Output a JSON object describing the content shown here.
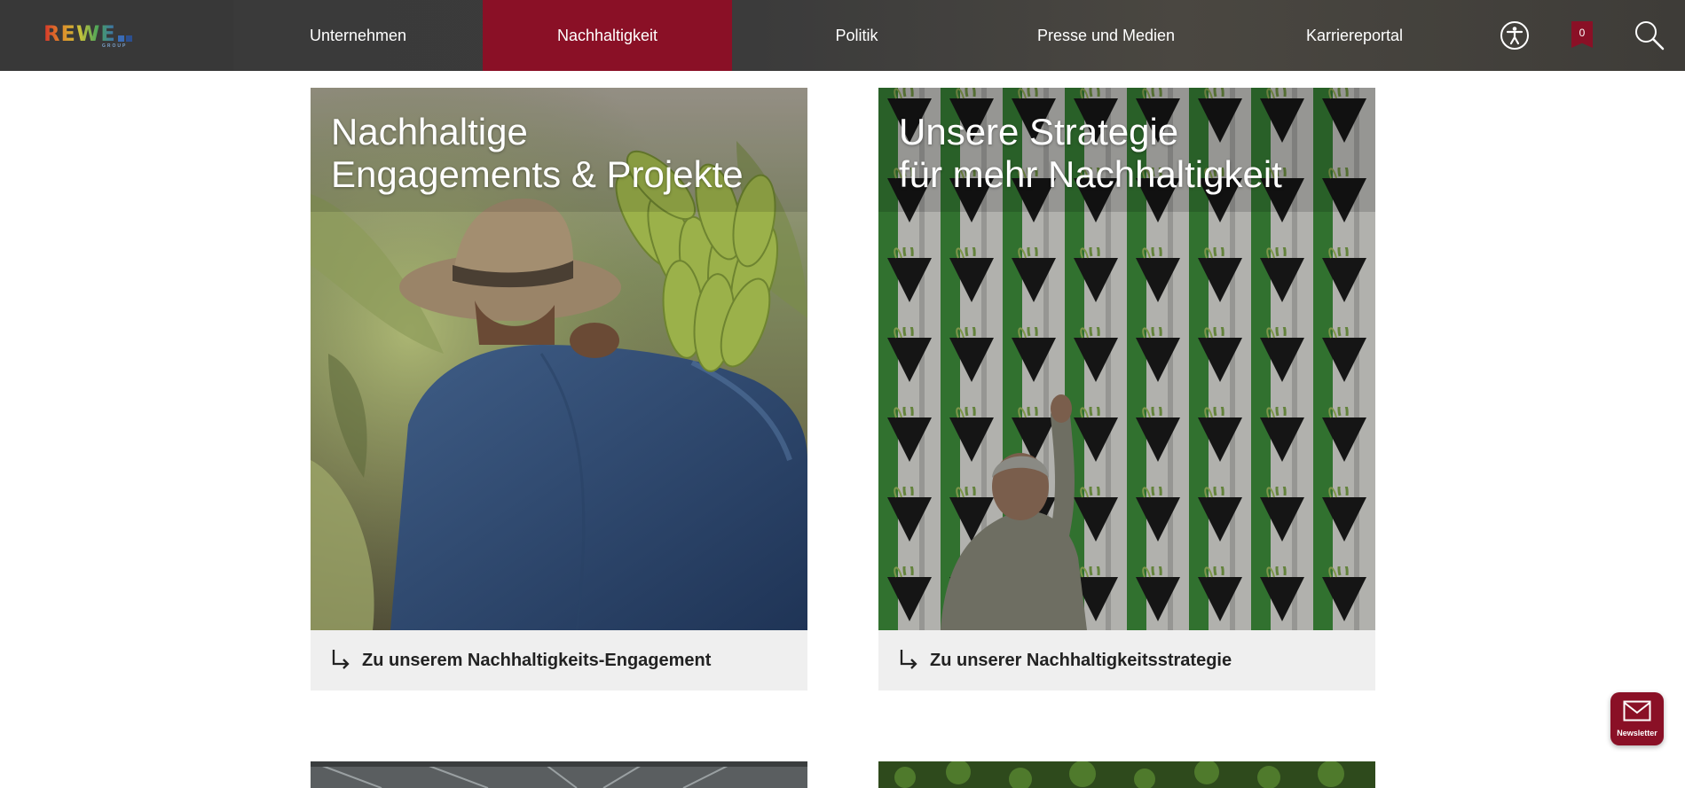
{
  "header": {
    "logo": {
      "word": "REWE",
      "sub": "GROUP",
      "colors": [
        "#d6332a",
        "#e08a2a",
        "#c9c23a",
        "#4aa55a",
        "#3a6bb5"
      ]
    },
    "nav": [
      {
        "label": "Unternehmen",
        "active": false
      },
      {
        "label": "Nachhaltigkeit",
        "active": true
      },
      {
        "label": "Politik",
        "active": false
      },
      {
        "label": "Presse und Medien",
        "active": false
      },
      {
        "label": "Karriereportal",
        "active": false
      }
    ],
    "icons": {
      "accessibility": "accessibility-icon",
      "bookmark": "bookmark-icon",
      "search": "search-icon"
    },
    "bookmark_count": "0",
    "accent_color": "#8a1026"
  },
  "cards": [
    {
      "title": "Nachhaltige\nEngagements & Projekte",
      "link_label": "Zu unserem Nachhaltigkeits-Engagement",
      "image": "farmer carrying bananas"
    },
    {
      "title": "Unsere Strategie\nfür mehr Nachhaltigkeit",
      "link_label": "Zu unserer Nachhaltigkeitsstrategie",
      "image": "vertical garden wall"
    }
  ],
  "newsletter": {
    "label": "Newsletter"
  }
}
